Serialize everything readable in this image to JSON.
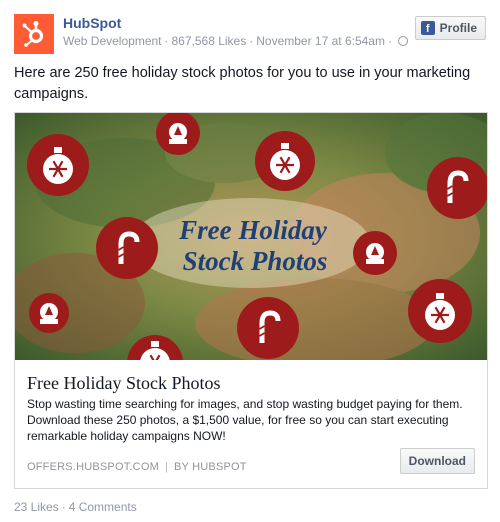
{
  "page": {
    "name": "HubSpot",
    "category": "Web Development",
    "likes": "867,568 Likes",
    "timestamp": "November 17 at 6:54am"
  },
  "profile_button": {
    "label": "Profile",
    "icon": "facebook-icon"
  },
  "post": {
    "text": "Here are 250 free holiday stock photos for you to use in your marketing campaigns."
  },
  "link_card": {
    "image_text_line1": "Free Holiday",
    "image_text_line2": "Stock Photos",
    "title": "Free Holiday Stock Photos",
    "description": "Stop wasting time searching for images, and stop wasting budget paying for them. Download these 250 photos, a $1,500 value, for free so you can start executing remarkable holiday campaigns NOW!",
    "domain": "OFFERS.HUBSPOT.COM",
    "byline": "BY HUBSPOT",
    "button_label": "Download"
  },
  "footer": {
    "likes": "23 Likes",
    "comments": "4 Comments"
  },
  "colors": {
    "brand": "#3b5998",
    "hubspot_orange": "#ff5c35",
    "ornament_red": "#9e1b1b"
  }
}
